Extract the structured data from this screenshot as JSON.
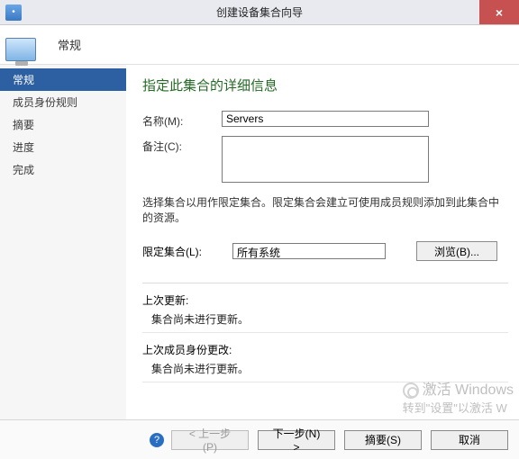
{
  "window": {
    "title": "创建设备集合向导",
    "close_glyph": "×"
  },
  "banner": {
    "title": "常规"
  },
  "sidebar": {
    "items": [
      {
        "label": "常规",
        "active": true
      },
      {
        "label": "成员身份规则",
        "active": false
      },
      {
        "label": "摘要",
        "active": false
      },
      {
        "label": "进度",
        "active": false
      },
      {
        "label": "完成",
        "active": false
      }
    ]
  },
  "main": {
    "heading": "指定此集合的详细信息",
    "name_label": "名称(M):",
    "name_value": "Servers",
    "comment_label": "备注(C):",
    "comment_value": "",
    "instruction": "选择集合以用作限定集合。限定集合会建立可使用成员规则添加到此集合中的资源。",
    "limited_label": "限定集合(L):",
    "limited_value": "所有系统",
    "browse_label": "浏览(B)...",
    "groups": {
      "last_update_title": "上次更新:",
      "last_update_body": "集合尚未进行更新。",
      "last_change_title": "上次成员身份更改:",
      "last_change_body": "集合尚未进行更新。"
    }
  },
  "footer": {
    "help_glyph": "?",
    "prev": "< 上一步(P)",
    "next": "下一步(N) >",
    "summary": "摘要(S)",
    "cancel": "取消"
  },
  "watermark": {
    "line1": "激活 Windows",
    "line2": "转到\"设置\"以激活 W"
  }
}
